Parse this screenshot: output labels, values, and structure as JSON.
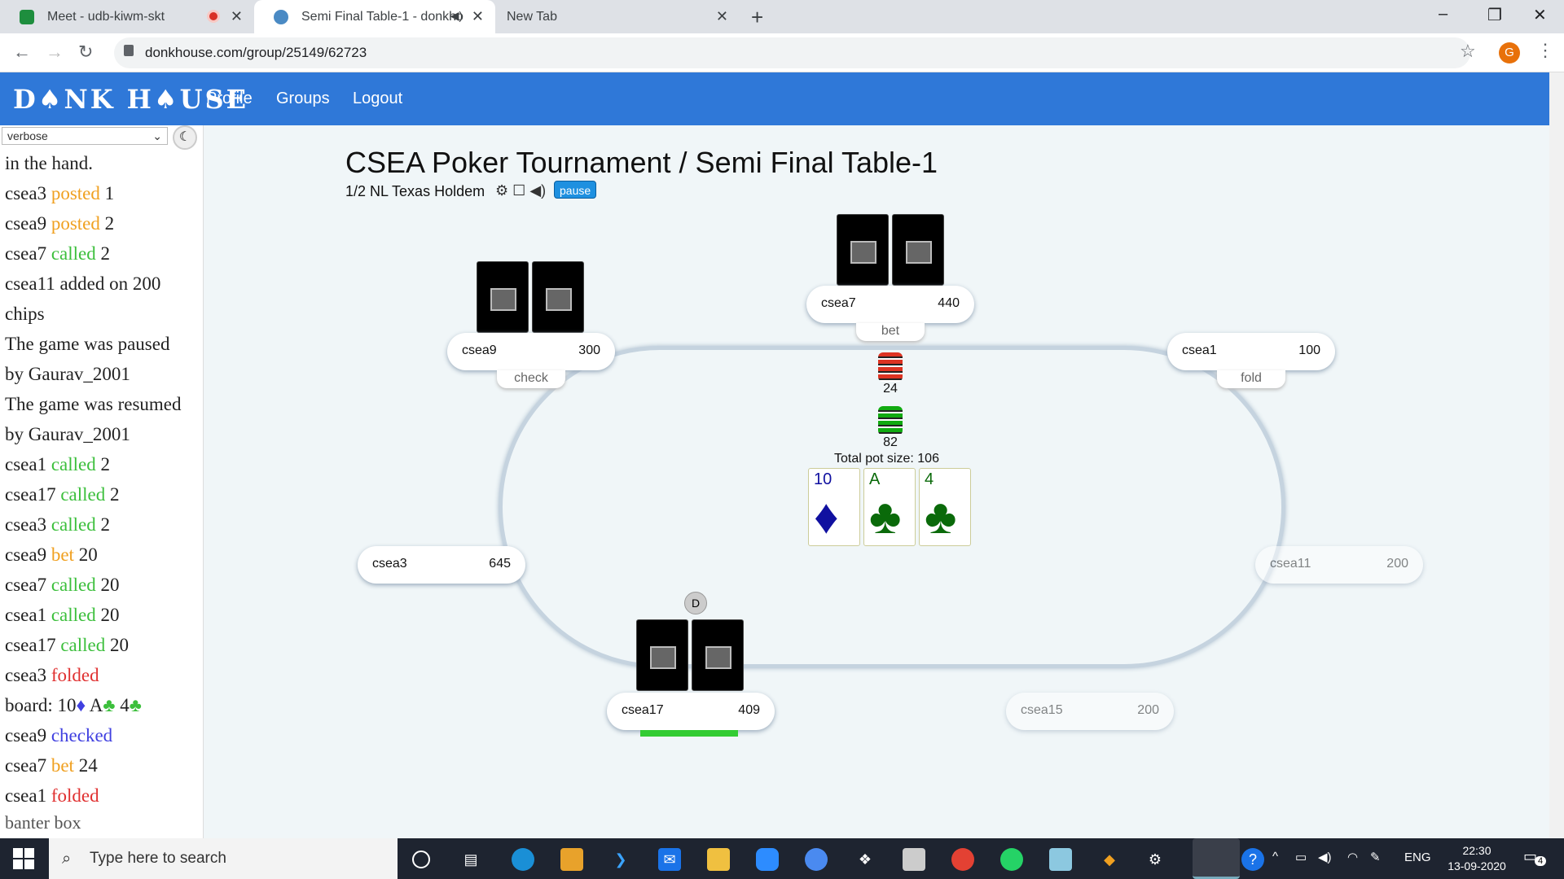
{
  "browser": {
    "tabs": [
      {
        "label": "Meet - udb-kiwm-skt",
        "icon": "meet-icon",
        "accent": "#1e8e3e"
      },
      {
        "label": "Semi Final Table-1 - donkho",
        "icon": "donkhouse-icon",
        "accent": "#4a8ac4"
      },
      {
        "label": "New Tab"
      }
    ],
    "url": "donkhouse.com/group/25149/62723",
    "profile_initial": "G"
  },
  "site": {
    "logo": "D♠NK H♠USE",
    "nav": [
      "Profile",
      "Groups",
      "Logout"
    ]
  },
  "sidebar": {
    "filter": "verbose",
    "log": [
      [
        [
          "in the hand.",
          ""
        ]
      ],
      [
        [
          "csea3 ",
          ""
        ],
        [
          "posted",
          "posted"
        ],
        [
          " 1",
          ""
        ]
      ],
      [
        [
          "csea9 ",
          ""
        ],
        [
          "posted",
          "posted"
        ],
        [
          " 2",
          ""
        ]
      ],
      [
        [
          "csea7 ",
          ""
        ],
        [
          "called",
          "called"
        ],
        [
          " 2",
          ""
        ]
      ],
      [
        [
          "csea11 added on 200",
          ""
        ]
      ],
      [
        [
          "chips",
          ""
        ]
      ],
      [
        [
          "The game was paused",
          ""
        ]
      ],
      [
        [
          "by Gaurav_2001",
          ""
        ]
      ],
      [
        [
          "The game was resumed",
          ""
        ]
      ],
      [
        [
          "by Gaurav_2001",
          ""
        ]
      ],
      [
        [
          "csea1 ",
          ""
        ],
        [
          "called",
          "called"
        ],
        [
          " 2",
          ""
        ]
      ],
      [
        [
          "csea17 ",
          ""
        ],
        [
          "called",
          "called"
        ],
        [
          " 2",
          ""
        ]
      ],
      [
        [
          "csea3 ",
          ""
        ],
        [
          "called",
          "called"
        ],
        [
          " 2",
          ""
        ]
      ],
      [
        [
          "csea9 ",
          ""
        ],
        [
          "bet",
          "bet"
        ],
        [
          " 20",
          ""
        ]
      ],
      [
        [
          "csea7 ",
          ""
        ],
        [
          "called",
          "called"
        ],
        [
          " 20",
          ""
        ]
      ],
      [
        [
          "csea1 ",
          ""
        ],
        [
          "called",
          "called"
        ],
        [
          " 20",
          ""
        ]
      ],
      [
        [
          "csea17 ",
          ""
        ],
        [
          "called",
          "called"
        ],
        [
          " 20",
          ""
        ]
      ],
      [
        [
          "csea3 ",
          ""
        ],
        [
          "folded",
          "folded"
        ]
      ],
      [
        [
          "board: 10",
          ""
        ],
        [
          "♦",
          "checked"
        ],
        [
          " A",
          ""
        ],
        [
          "♣",
          "called"
        ],
        [
          " 4",
          ""
        ],
        [
          "♣",
          "called"
        ]
      ],
      [
        [
          "csea9 ",
          ""
        ],
        [
          "checked",
          "checked"
        ]
      ],
      [
        [
          "csea7 ",
          ""
        ],
        [
          "bet",
          "bet"
        ],
        [
          " 24",
          ""
        ]
      ],
      [
        [
          "csea1 ",
          ""
        ],
        [
          "folded",
          "folded"
        ]
      ]
    ],
    "banter_placeholder": "banter box"
  },
  "game": {
    "title": "CSEA Poker Tournament / Semi Final Table-1",
    "subtitle": "1/2 NL Texas Holdem",
    "pause_label": "pause",
    "pot_label": "Total pot size: 106",
    "bet_chips": "24",
    "pot_chips": "82",
    "dealer": "D",
    "board": [
      {
        "rank": "10",
        "suit": "♦",
        "color": "#1010a0"
      },
      {
        "rank": "A",
        "suit": "♣",
        "color": "#0a6a0a"
      },
      {
        "rank": "4",
        "suit": "♣",
        "color": "#0a6a0a"
      }
    ],
    "seats": {
      "csea7": {
        "name": "csea7",
        "chips": "440",
        "action": "bet"
      },
      "csea9": {
        "name": "csea9",
        "chips": "300",
        "action": "check"
      },
      "csea1": {
        "name": "csea1",
        "chips": "100",
        "action": "fold"
      },
      "csea3": {
        "name": "csea3",
        "chips": "645"
      },
      "csea11": {
        "name": "csea11",
        "chips": "200"
      },
      "csea17": {
        "name": "csea17",
        "chips": "409"
      },
      "csea15": {
        "name": "csea15",
        "chips": "200"
      }
    }
  },
  "taskbar": {
    "search_placeholder": "Type here to search",
    "lang": "ENG",
    "time": "22:30",
    "date": "13-09-2020",
    "notifications": "4"
  }
}
